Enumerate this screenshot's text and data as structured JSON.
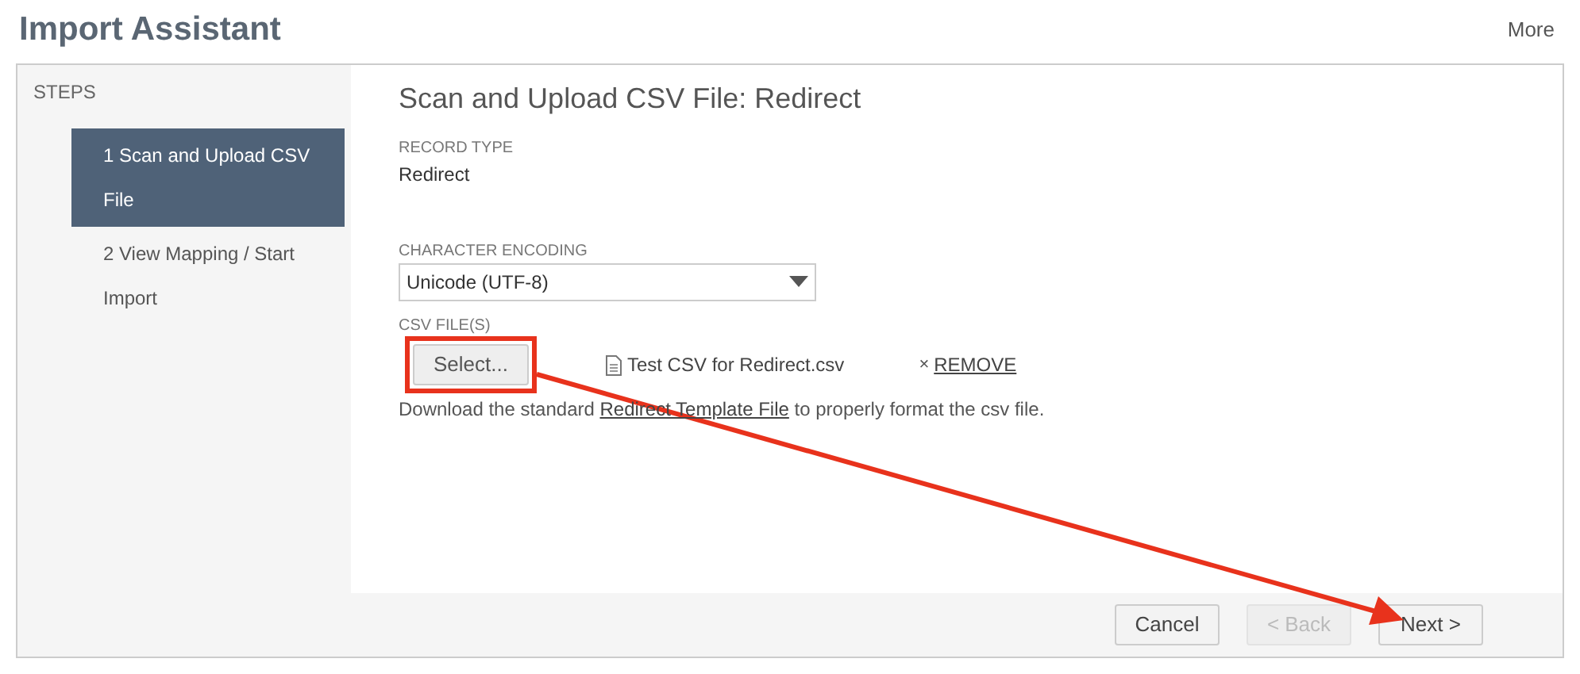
{
  "page_title": "Import Assistant",
  "more_link": "More",
  "steps": {
    "heading": "STEPS",
    "items": [
      {
        "label": "1 Scan and Upload CSV File",
        "selected": true
      },
      {
        "label": "2 View Mapping / Start Import",
        "selected": false
      }
    ]
  },
  "form": {
    "title": "Scan and Upload CSV File: Redirect",
    "record_type": {
      "label": "RECORD TYPE",
      "value": "Redirect"
    },
    "encoding": {
      "label": "CHARACTER ENCODING",
      "value": "Unicode (UTF-8)"
    },
    "csv_files": {
      "label": "CSV FILE(S)",
      "select_button": "Select...",
      "file_name": "Test CSV for Redirect.csv",
      "remove_icon": "×",
      "remove_link": "REMOVE"
    },
    "hint": {
      "before": "Download the standard ",
      "link": "Redirect Template File",
      "after": " to properly format the csv file."
    }
  },
  "buttons": [
    {
      "label": "Cancel",
      "disabled": false
    },
    {
      "label": "< Back",
      "disabled": true
    },
    {
      "label": "Next >",
      "disabled": false
    }
  ]
}
